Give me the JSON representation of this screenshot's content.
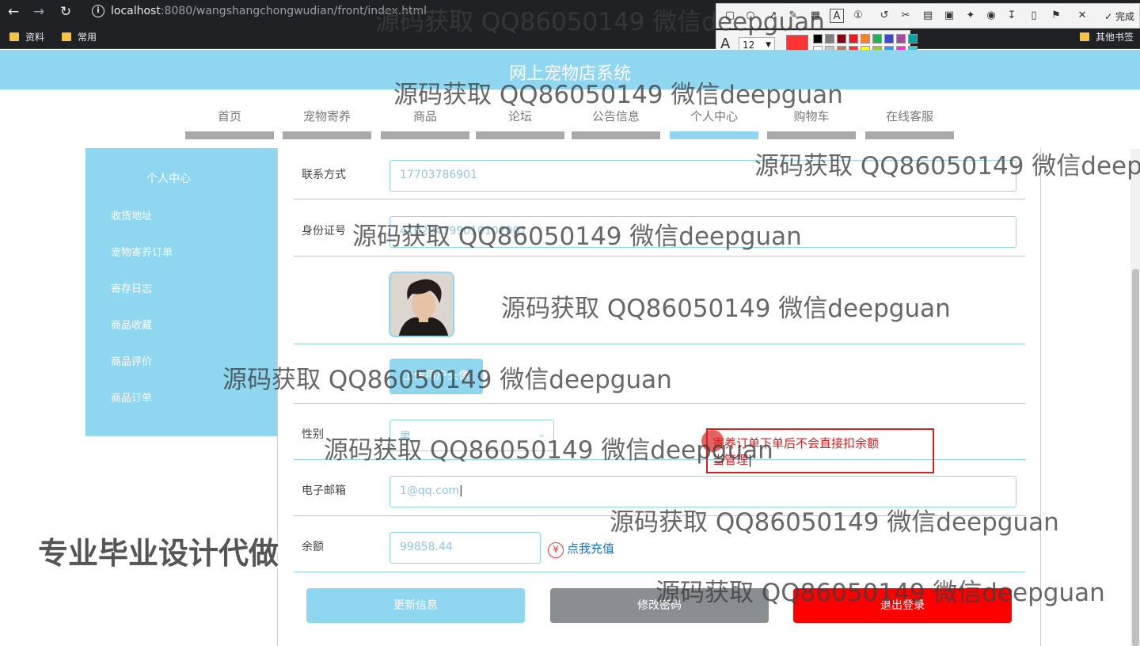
{
  "browser": {
    "url_host": "localhost",
    "url_path": ":8080/wangshangchongwudian/front/index.html",
    "bookmarks": [
      "资料",
      "常用"
    ],
    "bookmarks_right": "其他书签"
  },
  "snip_tool": {
    "done_label": "完成",
    "font_size": "12",
    "current_color": "#ff3333"
  },
  "site": {
    "title": "网上宠物店系统",
    "nav": [
      "首页",
      "宠物寄养",
      "商品",
      "论坛",
      "公告信息",
      "个人中心",
      "购物车",
      "在线客服"
    ],
    "active_nav": "个人中心"
  },
  "sidebar": {
    "title": "个人中心",
    "items": [
      "收货地址",
      "宠物寄养订单",
      "寄存日志",
      "商品收藏",
      "商品评价",
      "商品订单"
    ]
  },
  "form": {
    "contact_label": "联系方式",
    "contact_value": "17703786901",
    "idcard_label": "身份证号",
    "idcard_value": "410224199010102001",
    "upload_label": "上传用户头像",
    "gender_label": "性别",
    "gender_value": "男",
    "email_label": "电子邮箱",
    "email_value": "1@qq.com",
    "balance_label": "余额",
    "balance_value": "99858.44",
    "recharge_label": "点我充值",
    "recharge_icon": "yen-icon"
  },
  "buttons": {
    "update": "更新信息",
    "change_password": "修改密码",
    "logout": "退出登录",
    "colors": {
      "update": "#8fd6f0",
      "change_password": "#8a8d91",
      "logout": "#ff0000"
    }
  },
  "annotation": {
    "line1": "寄养订单下单后不会直接扣余额",
    "line2": "当管理"
  },
  "watermarks": {
    "text": "源码获取 QQ86050149 微信deepguan",
    "promo": "专业毕业设计代做"
  }
}
